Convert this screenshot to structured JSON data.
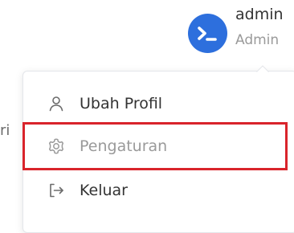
{
  "user": {
    "name": "admin",
    "role": "Admin",
    "avatar_icon": "terminal-icon",
    "avatar_color": "#2d6fdd"
  },
  "background": {
    "partial_text": "ri"
  },
  "menu": {
    "items": [
      {
        "label": "Ubah Profil",
        "icon": "user-icon"
      },
      {
        "label": "Pengaturan",
        "icon": "gear-icon"
      },
      {
        "label": "Keluar",
        "icon": "logout-icon"
      }
    ]
  },
  "highlight": {
    "color": "#d9242b"
  }
}
